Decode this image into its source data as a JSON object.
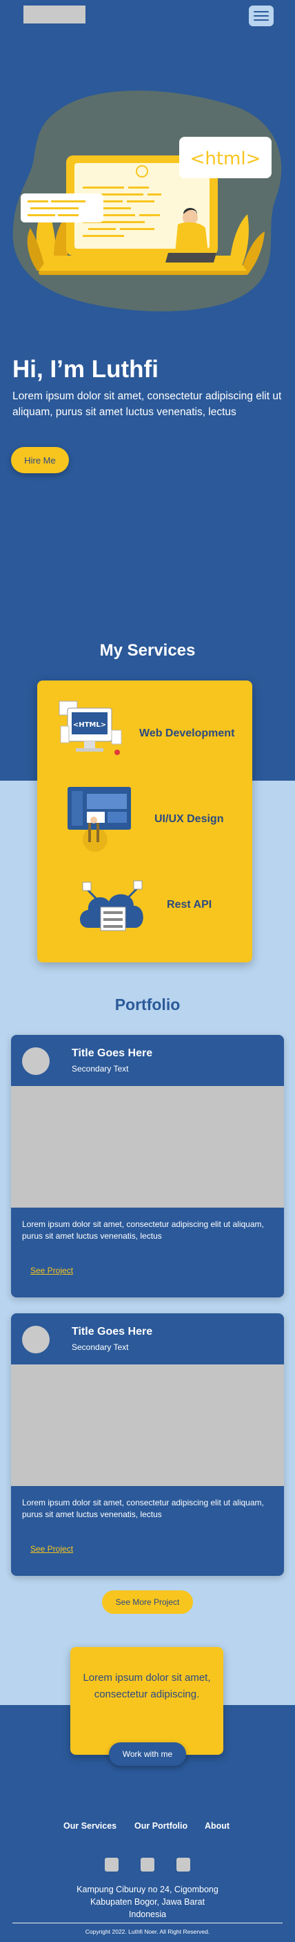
{
  "header": {
    "logo_alt": "",
    "menu_icon": "hamburger-icon"
  },
  "hero": {
    "code_label": "<html>",
    "title": "Hi, I’m Luthfi",
    "text": "Lorem ipsum dolor sit amet, consectetur adipiscing elit ut aliquam, purus sit amet luctus venenatis, lectus",
    "hire_label": "Hire Me"
  },
  "services": {
    "title": "My Services",
    "items": [
      {
        "label": "Web Development",
        "icon": "web-development-icon",
        "badge": "<HTML>"
      },
      {
        "label": "UI/UX Design",
        "icon": "ui-ux-design-icon"
      },
      {
        "label": "Rest API",
        "icon": "rest-api-icon"
      }
    ]
  },
  "portfolio": {
    "title": "Portfolio",
    "cards": [
      {
        "title": "Title Goes Here",
        "subtitle": "Secondary Text",
        "description": "Lorem ipsum dolor sit amet, consectetur adipiscing elit ut aliquam, purus sit amet luctus venenatis, lectus",
        "link": "See Project"
      },
      {
        "title": "Title Goes Here",
        "subtitle": "Secondary Text",
        "description": "Lorem ipsum dolor sit amet, consectetur adipiscing elit ut aliquam, purus sit amet luctus venenatis, lectus",
        "link": "See Project"
      }
    ],
    "see_more_label": "See More Project"
  },
  "cta": {
    "text": "Lorem ipsum dolor sit amet, consectetur adipiscing.",
    "button_label": "Work with me"
  },
  "footer": {
    "nav": [
      "Our Services",
      "Our Portfolio",
      "About"
    ],
    "social_icons": [
      "social-icon-1",
      "social-icon-2",
      "social-icon-3"
    ],
    "address_lines": [
      "Kampung Ciburuy no 24, Cigombong",
      "Kabupaten Bogor, Jawa Barat",
      "Indonesia"
    ],
    "copyright": "Copyright 2022. Luthfi Noer. All Right Reserved."
  },
  "colors": {
    "primary_blue": "#2b5999",
    "light_blue": "#b8d4ee",
    "accent_yellow": "#f8c51e",
    "dark_navy": "#2b4a82",
    "placeholder_gray": "#c4c4c4"
  }
}
